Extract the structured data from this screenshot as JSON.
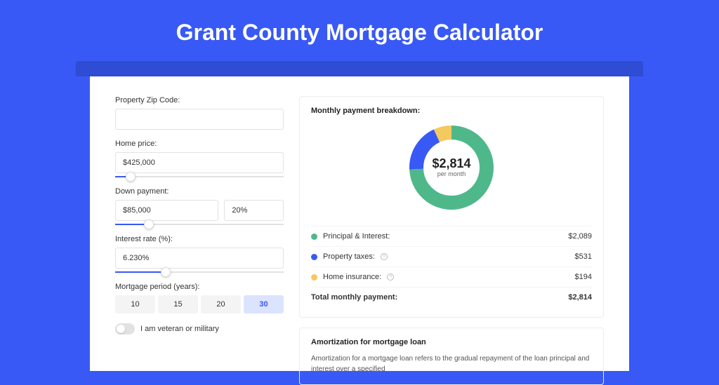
{
  "page_title": "Grant County Mortgage Calculator",
  "form": {
    "zip_label": "Property Zip Code:",
    "zip_value": "",
    "home_price_label": "Home price:",
    "home_price_value": "$425,000",
    "home_price_slider_pct": 9,
    "down_payment_label": "Down payment:",
    "down_payment_value": "$85,000",
    "down_payment_pct": "20%",
    "down_payment_slider_pct": 20,
    "interest_label": "Interest rate (%):",
    "interest_value": "6.230%",
    "interest_slider_pct": 30,
    "period_label": "Mortgage period (years):",
    "periods": [
      "10",
      "15",
      "20",
      "30"
    ],
    "period_active_index": 3,
    "veteran_label": "I am veteran or military"
  },
  "breakdown": {
    "title": "Monthly payment breakdown:",
    "amount": "$2,814",
    "sub": "per month",
    "items": [
      {
        "label": "Principal & Interest:",
        "value": "$2,089",
        "color": "green",
        "info": false
      },
      {
        "label": "Property taxes:",
        "value": "$531",
        "color": "blue",
        "info": true
      },
      {
        "label": "Home insurance:",
        "value": "$194",
        "color": "yellow",
        "info": true
      }
    ],
    "total_label": "Total monthly payment:",
    "total_value": "$2,814"
  },
  "chart_data": {
    "type": "pie",
    "title": "Monthly payment breakdown",
    "series": [
      {
        "name": "Principal & Interest",
        "value": 2089,
        "color": "#4fb88a"
      },
      {
        "name": "Property taxes",
        "value": 531,
        "color": "#3859f5"
      },
      {
        "name": "Home insurance",
        "value": 194,
        "color": "#f4c95d"
      }
    ],
    "total": 2814,
    "center_label": "$2,814",
    "center_sub": "per month"
  },
  "amortization": {
    "title": "Amortization for mortgage loan",
    "text": "Amortization for a mortgage loan refers to the gradual repayment of the loan principal and interest over a specified"
  }
}
